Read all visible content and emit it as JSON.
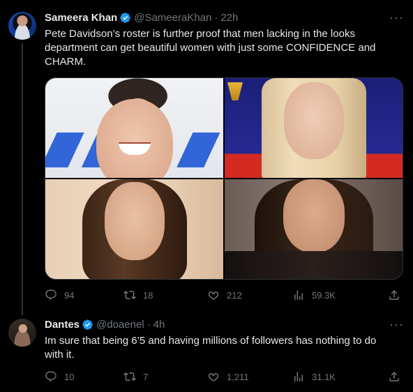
{
  "tweet1": {
    "name": "Sameera Khan",
    "handle": "@SameeraKhan",
    "dot": "·",
    "time": "22h",
    "text_line1": "Pete Davidson’s roster is further proof that men lacking in the looks",
    "text_line2": "department can get beautiful women with just some CONFIDENCE and",
    "text_line3": "CHARM.",
    "replies": "94",
    "retweets": "18",
    "likes": "212",
    "views": "59.3K"
  },
  "tweet2": {
    "name": "Dantes",
    "handle": "@doaenel",
    "dot": "·",
    "time": "4h",
    "text_line1": "Im sure that being 6’5 and having millions of followers has nothing to do",
    "text_line2": "with it.",
    "replies": "10",
    "retweets": "7",
    "likes": "1,211",
    "views": "31.1K"
  },
  "icons": {
    "verified": "verified-badge-icon",
    "more": "more-horizontal-icon",
    "reply": "reply-icon",
    "retweet": "retweet-icon",
    "like": "heart-icon",
    "views": "views-chart-icon",
    "share": "share-icon"
  },
  "colors": {
    "background": "#000000",
    "text": "#e7e9ea",
    "secondary": "#71767b",
    "verified": "#1d9bf0"
  },
  "more_glyph": "···"
}
